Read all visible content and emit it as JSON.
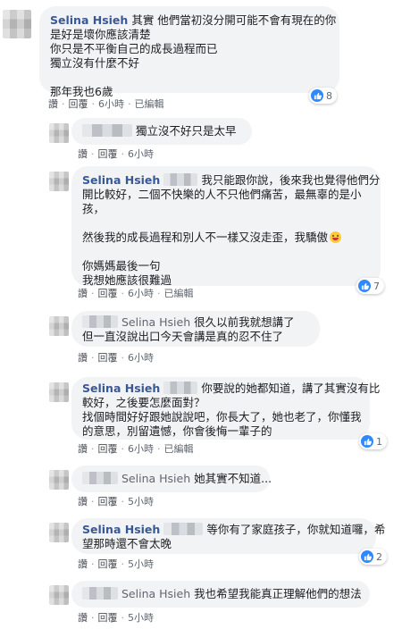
{
  "comments": [
    {
      "author": "Selina Hsieh",
      "lines": [
        "其實 他們當初沒分開可能不會有現在的你",
        "是好是壞你應該清楚",
        "你只是不平衡自己的成長過程而已",
        "獨立沒有什麼不好",
        "",
        "那年我也6歲"
      ],
      "actions": {
        "like": "讚",
        "reply": "回覆",
        "time": "6小時",
        "edited": "已編輯"
      },
      "reactions": "8"
    },
    {
      "lines": [
        "獨立沒不好只是太早"
      ],
      "actions": {
        "like": "讚",
        "reply": "回覆",
        "time": "6小時"
      }
    },
    {
      "author": "Selina Hsieh",
      "lines": [
        "我只能跟你說，後來我也覺得他們分",
        "開比較好，二個不快樂的人不只他們痛苦，最無辜的是小",
        "孩，",
        "",
        "然後我的成長過程和別人不一樣又沒走歪，我驕傲",
        "",
        "你媽媽最後一句",
        "我想她應該很難過"
      ],
      "actions": {
        "like": "讚",
        "reply": "回覆",
        "time": "6小時",
        "edited": "已編輯"
      },
      "reactions": "7"
    },
    {
      "tag": "Selina Hsieh",
      "lines": [
        "很久以前我就想講了",
        "但一直沒說出口今天會講是真的忍不住了"
      ],
      "actions": {
        "like": "讚",
        "reply": "回覆",
        "time": "6小時"
      }
    },
    {
      "author": "Selina Hsieh",
      "lines": [
        "你要說的她都知道，講了其實沒有比",
        "較好，之後要怎麼面對？",
        "找個時間好好跟她說說吧，你長大了，她也老了，你懂我",
        "的意思，別留遺憾，你會後悔一輩子的"
      ],
      "actions": {
        "like": "讚",
        "reply": "回覆",
        "time": "6小時",
        "edited": "已編輯"
      },
      "reactions": "1"
    },
    {
      "tag": "Selina Hsieh",
      "lines": [
        "她其實不知道..."
      ],
      "actions": {
        "like": "讚",
        "reply": "回覆",
        "time": "5小時"
      }
    },
    {
      "author": "Selina Hsieh",
      "lines": [
        "等你有了家庭孩子，你就知道囉，希",
        "望那時還不會太晚"
      ],
      "actions": {
        "like": "讚",
        "reply": "回覆",
        "time": "5小時"
      },
      "reactions": "2"
    },
    {
      "tag": "Selina Hsieh",
      "lines": [
        "我也希望我能真正理解他們的想法"
      ],
      "actions": {
        "like": "讚",
        "reply": "回覆",
        "time": "5小時"
      }
    }
  ],
  "colors": {
    "author": "#385898",
    "bubble": "#f2f3f5",
    "like": "#2e89ff"
  },
  "icons": {
    "like": "thumbs-up-icon",
    "emoji": "grinning-face-icon"
  }
}
